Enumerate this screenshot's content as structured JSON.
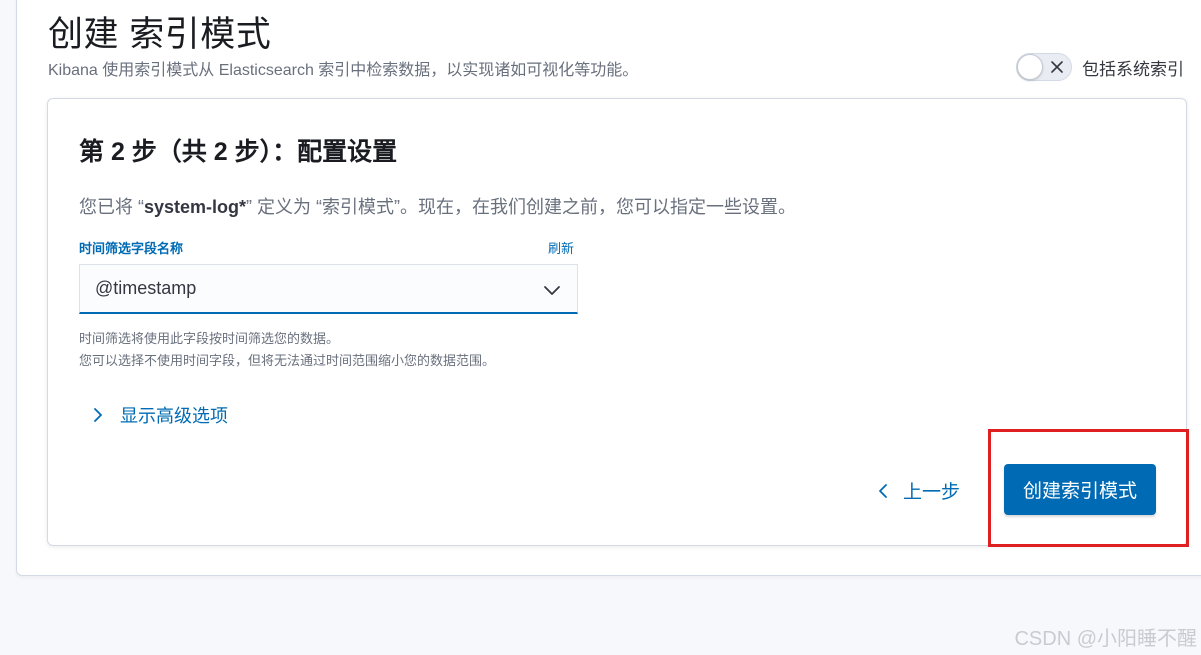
{
  "header": {
    "title": "创建 索引模式",
    "subtitle": "Kibana 使用索引模式从 Elasticsearch 索引中检索数据，以实现诸如可视化等功能。"
  },
  "include_system_indices": {
    "label": "包括系统索引",
    "checked": false
  },
  "step": {
    "title": "第 2 步（共 2 步）：配置设置",
    "desc_prefix": "您已将 “",
    "pattern": "system-log*",
    "desc_suffix": "” 定义为 “索引模式”。现在，在我们创建之前，您可以指定一些设置。"
  },
  "time_field": {
    "label": "时间筛选字段名称",
    "refresh_label": "刷新",
    "selected": "@timestamp",
    "help_line1": "时间筛选将使用此字段按时间筛选您的数据。",
    "help_line2": "您可以选择不使用时间字段，但将无法通过时间范围缩小您的数据范围。"
  },
  "advanced": {
    "label": "显示高级选项"
  },
  "actions": {
    "back_label": "上一步",
    "create_label": "创建索引模式"
  },
  "watermark": "CSDN @小阳睡不醒",
  "colors": {
    "accent": "#006bb4",
    "highlight": "#e02020"
  }
}
